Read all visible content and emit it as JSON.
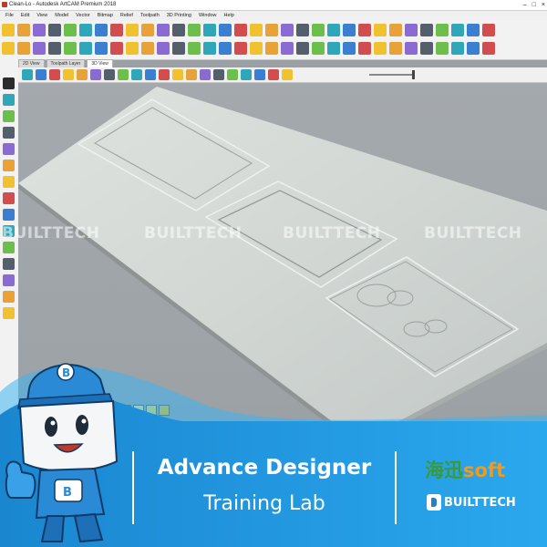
{
  "window": {
    "title": "Clean-Lo - Autodesk ArtCAM Premium 2018",
    "controls": [
      "–",
      "□",
      "×"
    ]
  },
  "menu": [
    "File",
    "Edit",
    "View",
    "Model",
    "Vector",
    "Bitmap",
    "Relief",
    "Toolpath",
    "3D Printing",
    "Window",
    "Help"
  ],
  "tabs": [
    {
      "label": "2D View",
      "active": false
    },
    {
      "label": "Toolpath Layer",
      "active": false
    },
    {
      "label": "3D View",
      "active": true
    }
  ],
  "watermark": "BUILTTECH",
  "palette": [
    "#6a1a8a",
    "#d81b60",
    "#f5f08a",
    "#f2e34a",
    "#f2c418"
  ],
  "banner": {
    "title": "Advance Designer",
    "subtitle": "Training Lab",
    "logo_cn": "海迅",
    "logo_soft": "soft",
    "logo_builttech": "BUILTTECH"
  },
  "colors": {
    "banner_blue": "#1d8fd8",
    "banner_light": "#28a5ea",
    "viewport_bg": "#9ea3a7",
    "plate": "#d3d8d6",
    "orange": "#f19a1d",
    "green": "#3a9a3a"
  },
  "icons": {
    "toolbar_row1": [
      "new-file-icon",
      "open-icon",
      "save-icon",
      "cut-icon",
      "copy-icon",
      "paste-icon",
      "undo-icon",
      "redo-icon",
      "print-icon",
      "layers-icon",
      "grid-icon",
      "snap-icon",
      "measure-icon",
      "vector-icon",
      "node-icon",
      "merge-icon",
      "trim-icon",
      "offset-icon",
      "fillet-icon",
      "text-icon",
      "bitmap-icon",
      "relief-icon",
      "shape-icon",
      "extrude-icon",
      "spin-icon",
      "sweep-icon",
      "weave-icon",
      "texture-icon",
      "toolpath-icon",
      "simulate-icon",
      "export-icon",
      "settings-icon"
    ],
    "toolbar_row2": [
      "zoom-icon",
      "pan-icon",
      "rotate-icon",
      "select-icon",
      "box-icon",
      "cube-icon",
      "plane-icon",
      "lamp-icon",
      "lock-icon",
      "warp-icon",
      "smooth-icon",
      "sculpt-icon",
      "stamp-icon",
      "fade-icon",
      "wizard-icon",
      "add-icon",
      "subtract-icon",
      "merge-high-icon",
      "merge-low-icon",
      "zero-icon",
      "scale-icon",
      "mirror-icon",
      "invert-icon",
      "split-icon",
      "texture-relief-icon",
      "cluster-icon",
      "slice-icon",
      "flatten-icon",
      "tilt-icon",
      "fade-relief-icon",
      "border-icon",
      "calc-icon"
    ],
    "view_bar": [
      "iso-view-icon",
      "top-view-icon",
      "front-view-icon",
      "side-view-icon",
      "zoom-fit-icon",
      "light-icon",
      "material-icon",
      "axis-icon",
      "origin-icon",
      "render-icon",
      "shaded-icon",
      "wireframe-icon",
      "smooth-shade-icon",
      "gradient-icon",
      "eye-icon",
      "hide-icon",
      "color-icon",
      "paint-icon",
      "split-view-icon",
      "show-vectors-icon"
    ],
    "left_tools": [
      "pointer-icon",
      "node-edit-icon",
      "transform-icon",
      "grid-tool-icon",
      "pencil-icon",
      "paint-bucket-icon",
      "eraser-icon",
      "rectangle-icon",
      "circle-icon",
      "polygon-icon",
      "arc-icon",
      "text-tool-icon",
      "dropper-icon",
      "brush-icon",
      "pen-icon"
    ]
  }
}
